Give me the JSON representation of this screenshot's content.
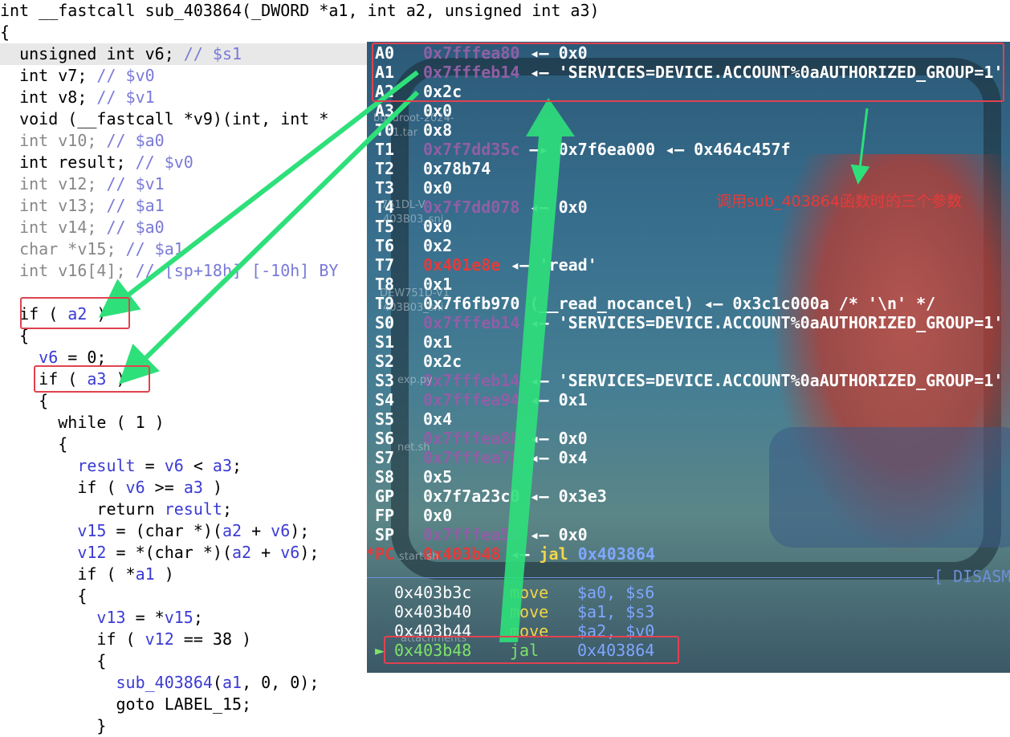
{
  "code": {
    "lines": [
      [
        {
          "c": "plain",
          "t": "int __fastcall sub_403864(_DWORD *a1, int a2, unsigned int a3)"
        }
      ],
      [
        {
          "c": "plain",
          "t": "{"
        }
      ],
      [
        {
          "c": "plain",
          "t": "  unsigned int v6; "
        },
        {
          "c": "com",
          "t": "// $s1"
        }
      ],
      [
        {
          "c": "plain",
          "t": "  int v7; "
        },
        {
          "c": "com",
          "t": "// $v0"
        }
      ],
      [
        {
          "c": "plain",
          "t": "  int v8; "
        },
        {
          "c": "com",
          "t": "// $v1"
        }
      ],
      [
        {
          "c": "plain",
          "t": "  void (__fastcall *v9)(int, int *"
        }
      ],
      [
        {
          "c": "gray",
          "t": "  int v10; "
        },
        {
          "c": "com",
          "t": "// $a0"
        }
      ],
      [
        {
          "c": "plain",
          "t": "  int result; "
        },
        {
          "c": "com",
          "t": "// $v0"
        }
      ],
      [
        {
          "c": "gray",
          "t": "  int v12; "
        },
        {
          "c": "com",
          "t": "// $v1"
        }
      ],
      [
        {
          "c": "gray",
          "t": "  int v13; "
        },
        {
          "c": "com",
          "t": "// $a1"
        }
      ],
      [
        {
          "c": "gray",
          "t": "  int v14; "
        },
        {
          "c": "com",
          "t": "// $a0"
        }
      ],
      [
        {
          "c": "gray",
          "t": "  char *v15; "
        },
        {
          "c": "com",
          "t": "// $a1"
        }
      ],
      [
        {
          "c": "gray",
          "t": "  int v16[4]; "
        },
        {
          "c": "com",
          "t": "// [sp+18h] [-10h] BY"
        }
      ],
      [
        {
          "c": "plain",
          "t": ""
        }
      ],
      [
        {
          "c": "plain",
          "t": "  if ( "
        },
        {
          "c": "var",
          "t": "a2"
        },
        {
          "c": "plain",
          "t": " )"
        }
      ],
      [
        {
          "c": "plain",
          "t": "  {"
        }
      ],
      [
        {
          "c": "plain",
          "t": "    "
        },
        {
          "c": "var",
          "t": "v6"
        },
        {
          "c": "plain",
          "t": " = 0;"
        }
      ],
      [
        {
          "c": "plain",
          "t": "    if ( "
        },
        {
          "c": "var",
          "t": "a3"
        },
        {
          "c": "plain",
          "t": " )"
        }
      ],
      [
        {
          "c": "plain",
          "t": "    {"
        }
      ],
      [
        {
          "c": "plain",
          "t": "      while ( 1 )"
        }
      ],
      [
        {
          "c": "plain",
          "t": "      {"
        }
      ],
      [
        {
          "c": "plain",
          "t": "        "
        },
        {
          "c": "var",
          "t": "result"
        },
        {
          "c": "plain",
          "t": " = "
        },
        {
          "c": "var",
          "t": "v6"
        },
        {
          "c": "plain",
          "t": " < "
        },
        {
          "c": "var",
          "t": "a3"
        },
        {
          "c": "plain",
          "t": ";"
        }
      ],
      [
        {
          "c": "plain",
          "t": "        if ( "
        },
        {
          "c": "var",
          "t": "v6"
        },
        {
          "c": "plain",
          "t": " >= "
        },
        {
          "c": "var",
          "t": "a3"
        },
        {
          "c": "plain",
          "t": " )"
        }
      ],
      [
        {
          "c": "plain",
          "t": "          return "
        },
        {
          "c": "var",
          "t": "result"
        },
        {
          "c": "plain",
          "t": ";"
        }
      ],
      [
        {
          "c": "plain",
          "t": "        "
        },
        {
          "c": "var",
          "t": "v15"
        },
        {
          "c": "plain",
          "t": " = (char *)("
        },
        {
          "c": "var",
          "t": "a2"
        },
        {
          "c": "plain",
          "t": " + "
        },
        {
          "c": "var",
          "t": "v6"
        },
        {
          "c": "plain",
          "t": ");"
        }
      ],
      [
        {
          "c": "plain",
          "t": "        "
        },
        {
          "c": "var",
          "t": "v12"
        },
        {
          "c": "plain",
          "t": " = *(char *)("
        },
        {
          "c": "var",
          "t": "a2"
        },
        {
          "c": "plain",
          "t": " + "
        },
        {
          "c": "var",
          "t": "v6"
        },
        {
          "c": "plain",
          "t": ");"
        }
      ],
      [
        {
          "c": "plain",
          "t": "        if ( *"
        },
        {
          "c": "var",
          "t": "a1"
        },
        {
          "c": "plain",
          "t": " )"
        }
      ],
      [
        {
          "c": "plain",
          "t": "        {"
        }
      ],
      [
        {
          "c": "plain",
          "t": "          "
        },
        {
          "c": "var",
          "t": "v13"
        },
        {
          "c": "plain",
          "t": " = *"
        },
        {
          "c": "var",
          "t": "v15"
        },
        {
          "c": "plain",
          "t": ";"
        }
      ],
      [
        {
          "c": "plain",
          "t": "          if ( "
        },
        {
          "c": "var",
          "t": "v12"
        },
        {
          "c": "plain",
          "t": " == 38 )"
        }
      ],
      [
        {
          "c": "plain",
          "t": "          {"
        }
      ],
      [
        {
          "c": "plain",
          "t": "            "
        },
        {
          "c": "var",
          "t": "sub_403864"
        },
        {
          "c": "plain",
          "t": "("
        },
        {
          "c": "var",
          "t": "a1"
        },
        {
          "c": "plain",
          "t": ", 0, 0);"
        }
      ],
      [
        {
          "c": "plain",
          "t": "            goto LABEL_15;"
        }
      ],
      [
        {
          "c": "plain",
          "t": "          }"
        }
      ]
    ]
  },
  "registers": [
    {
      "name": "A0",
      "addr": "0x7fffea80",
      "rest": " ◂— 0x0"
    },
    {
      "name": "A1",
      "addr": "0x7fffeb14",
      "rest": " ◂— 'SERVICES=DEVICE.ACCOUNT%0aAUTHORIZED_GROUP=1'"
    },
    {
      "name": "A2",
      "val": "0x2c"
    },
    {
      "name": "A3",
      "val": "0x0"
    },
    {
      "name": "T0",
      "val": "0x8"
    },
    {
      "name": "T1",
      "addr": "0x7f7dd35c",
      "rest": " —▸ 0x7f6ea000 ◂— 0x464c457f"
    },
    {
      "name": "T2",
      "val": "0x78b74"
    },
    {
      "name": "T3",
      "val": "0x0"
    },
    {
      "name": "T4",
      "addr": "0x7f7dd078",
      "rest": " ◂— 0x0"
    },
    {
      "name": "T5",
      "val": "0x0"
    },
    {
      "name": "T6",
      "val": "0x2"
    },
    {
      "name": "T7",
      "red": "0x401e8e",
      "rest": " ◂— 'read'"
    },
    {
      "name": "T8",
      "val": "0x1"
    },
    {
      "name": "T9",
      "val": "0x7f6fb970",
      "rest": " (__read_nocancel) ◂— 0x3c1c000a /* '\\n' */"
    },
    {
      "name": "S0",
      "addr": "0x7fffeb14",
      "rest": " ◂— 'SERVICES=DEVICE.ACCOUNT%0aAUTHORIZED_GROUP=1'"
    },
    {
      "name": "S1",
      "val": "0x1"
    },
    {
      "name": "S2",
      "val": "0x2c"
    },
    {
      "name": "S3",
      "addr": "0x7fffeb14",
      "rest": " ◂— 'SERVICES=DEVICE.ACCOUNT%0aAUTHORIZED_GROUP=1'"
    },
    {
      "name": "S4",
      "addr": "0x7fffea94",
      "rest": " ◂— 0x1"
    },
    {
      "name": "S5",
      "val": "0x4"
    },
    {
      "name": "S6",
      "addr": "0x7fffea80",
      "rest": " ◂— 0x0"
    },
    {
      "name": "S7",
      "addr": "0x7fffea78",
      "rest": " ◂— 0x4"
    },
    {
      "name": "S8",
      "val": "0x5"
    },
    {
      "name": "GP",
      "val": "0x7f7a23c0",
      "rest": " ◂— 0x3e3"
    },
    {
      "name": "FP",
      "val": "0x0"
    },
    {
      "name": "SP",
      "addr": "0x7fffea58",
      "rest": " ◂— 0x0"
    },
    {
      "name": "*PC",
      "red": "0x403b48",
      "rest": " ◂— ",
      "op": "jal",
      "tgt": " 0x403864"
    }
  ],
  "disasm": {
    "header": "[ DISASM",
    "lines": [
      {
        "addr": "0x403b3c",
        "mnem": "move",
        "ops": "$a0, $s6"
      },
      {
        "addr": "0x403b40",
        "mnem": "move",
        "ops": "$a1, $s3"
      },
      {
        "addr": "0x403b44",
        "mnem": "move",
        "ops": "$a2, $v0"
      },
      {
        "addr": "0x403b48",
        "mnem": "jal",
        "ops": "0x403864",
        "current": true
      }
    ],
    "marker": "►"
  },
  "desktop_ghosts": [
    "buildroot-2024-",
    "01.tar",
    "751DL-V",
    "403B03_sni",
    "DEW751D-V1",
    "403B03_sni",
    "exp.py",
    "net.sh",
    "start.sh",
    "attachments"
  ],
  "annotation": "调用sub_403864函数时的三个参数",
  "colors": {
    "annot": "#e63b3b",
    "arrow": "#2ee07a",
    "box": "#e04250"
  }
}
